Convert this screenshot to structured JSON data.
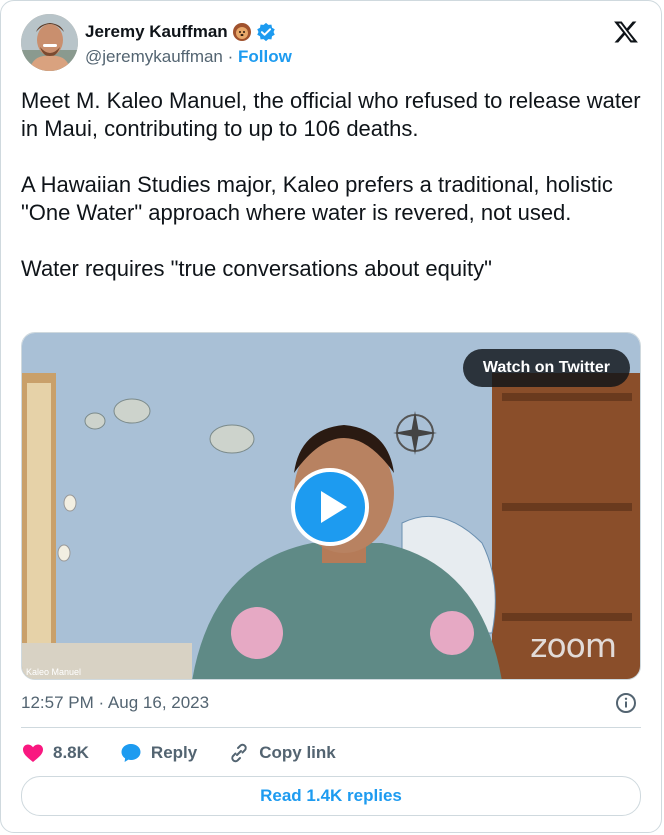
{
  "author": {
    "name": "Jeremy Kauffman",
    "handle": "@jeremykauffman",
    "separator": "·",
    "follow_label": "Follow",
    "badge_icon": "lion-emoji-icon",
    "verified_icon": "verified-badge-icon",
    "verified_color": "#1d9bf0"
  },
  "tweet": {
    "paragraphs": [
      "Meet M. Kaleo Manuel, the official who refused to release water in Maui, contributing to up to 106 deaths.",
      "A Hawaiian Studies major, Kaleo prefers a traditional, holistic \"One Water\" approach where water is revered, not used.",
      "Water requires \"true conversations about equity\""
    ]
  },
  "media": {
    "watch_label": "Watch on Twitter",
    "zoom_watermark": "zoom",
    "participant_caption": "Kaleo Manuel",
    "play_icon": "play-icon",
    "play_color": "#1d9bf0"
  },
  "timestamp": "12:57 PM · Aug 16, 2023",
  "actions": {
    "like_count": "8.8K",
    "like_color": "#f91880",
    "reply_label": "Reply",
    "copy_label": "Copy link"
  },
  "replies_button": "Read 1.4K replies",
  "brand": {
    "accent": "#1d9bf0",
    "x_logo": "x-logo-icon"
  }
}
